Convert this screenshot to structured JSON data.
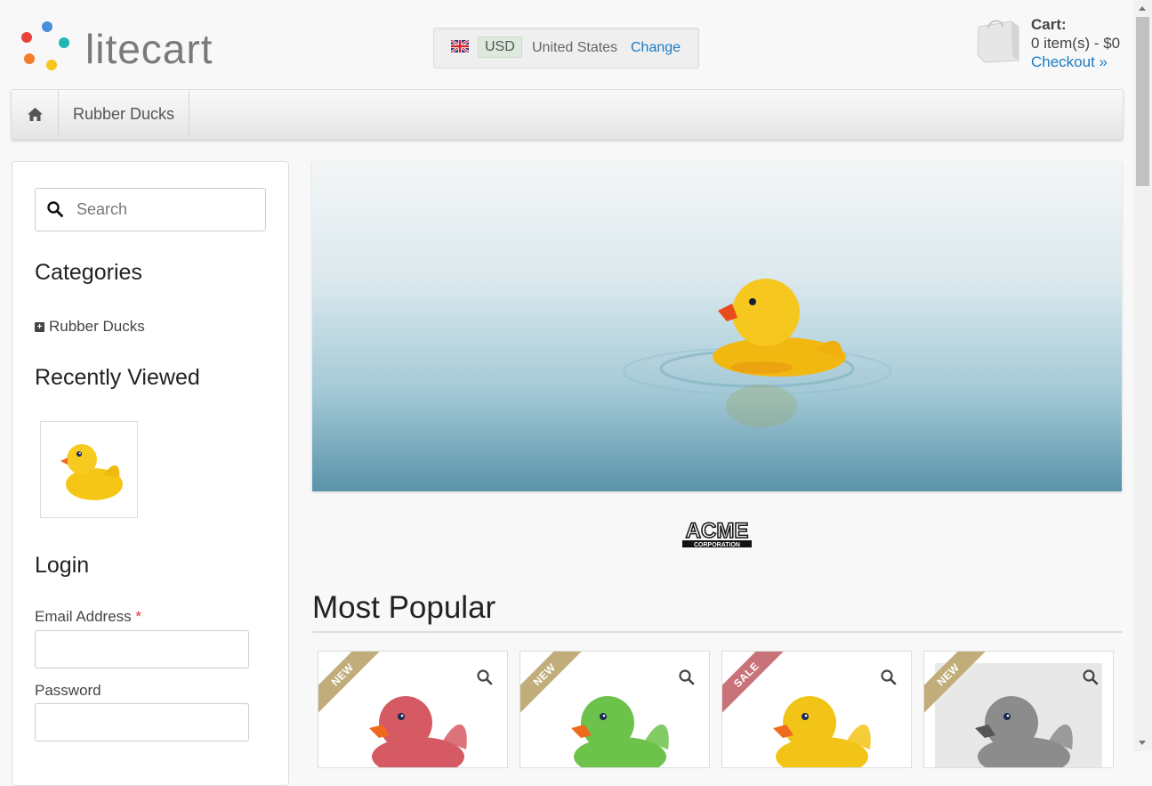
{
  "header": {
    "logo_text": "litecart",
    "region": {
      "currency": "USD",
      "country": "United States",
      "change_label": "Change"
    },
    "cart": {
      "label": "Cart:",
      "summary": "0 item(s) - $0",
      "checkout_label": "Checkout »"
    }
  },
  "nav": {
    "home_icon": "home-icon",
    "items": [
      "Rubber Ducks"
    ]
  },
  "sidebar": {
    "search_placeholder": "Search",
    "categories_title": "Categories",
    "categories": [
      "Rubber Ducks"
    ],
    "recently_viewed_title": "Recently Viewed",
    "login_title": "Login",
    "email_label": "Email Address",
    "email_required": "*",
    "password_label": "Password"
  },
  "banner": {
    "brand_logo_text": "ACME CORPORATION"
  },
  "most_popular": {
    "title": "Most Popular",
    "products": [
      {
        "badge": "NEW",
        "badge_color": "#c0ad7a",
        "duck_color": "#d65a63"
      },
      {
        "badge": "NEW",
        "badge_color": "#c0ad7a",
        "duck_color": "#6cc24a"
      },
      {
        "badge": "SALE",
        "badge_color": "#c8737a",
        "duck_color": "#f3c418"
      },
      {
        "badge": "NEW",
        "badge_color": "#c0ad7a",
        "duck_color": "#8c8c8c"
      }
    ]
  },
  "colors": {
    "link": "#1a7cc4",
    "accent_green": "#dde9dd"
  }
}
